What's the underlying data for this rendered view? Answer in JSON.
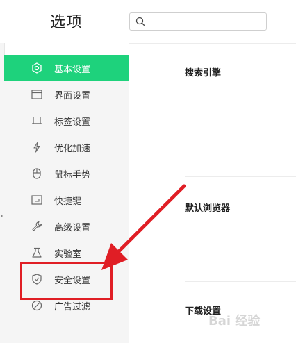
{
  "header": {
    "title": "选项",
    "search_placeholder": ""
  },
  "sidebar": {
    "items": [
      {
        "label": "基本设置",
        "icon": "settings-icon",
        "active": true
      },
      {
        "label": "界面设置",
        "icon": "window-icon",
        "active": false
      },
      {
        "label": "标签设置",
        "icon": "tab-icon",
        "active": false
      },
      {
        "label": "优化加速",
        "icon": "lightning-icon",
        "active": false
      },
      {
        "label": "鼠标手势",
        "icon": "mouse-icon",
        "active": false
      },
      {
        "label": "快捷键",
        "icon": "keyboard-icon",
        "active": false
      },
      {
        "label": "高级设置",
        "icon": "wrench-icon",
        "active": false
      },
      {
        "label": "实验室",
        "icon": "flask-icon",
        "active": false
      },
      {
        "label": "安全设置",
        "icon": "shield-icon",
        "active": false
      },
      {
        "label": "广告过滤",
        "icon": "block-icon",
        "active": false
      }
    ]
  },
  "main": {
    "sections": [
      {
        "title": "搜索引擎"
      },
      {
        "title": "默认浏览器"
      },
      {
        "title": "下载设置"
      }
    ]
  },
  "colors": {
    "accent": "#1ed27c",
    "annotation": "#e01e25",
    "sidebar_bg": "#f5f5f5"
  },
  "watermark": {
    "text": "Bai 经验"
  }
}
